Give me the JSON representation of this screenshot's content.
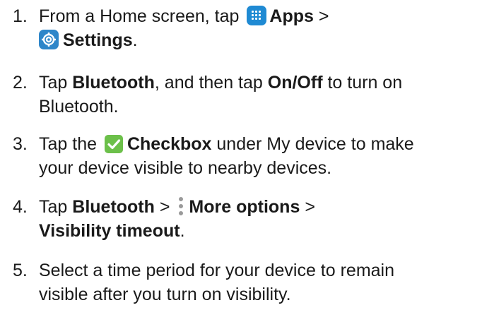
{
  "steps": [
    {
      "num": "1.",
      "parts": {
        "a": "From a Home screen, tap",
        "apps": "Apps",
        "sep": ">",
        "settings": "Settings",
        "end": "."
      },
      "icons": [
        "apps-icon",
        "settings-icon"
      ]
    },
    {
      "num": "2.",
      "parts": {
        "a": "Tap",
        "bluetooth": "Bluetooth",
        "b": ", and then tap",
        "onoff": "On/Off",
        "c": "to turn on",
        "d": "Bluetooth."
      }
    },
    {
      "num": "3.",
      "parts": {
        "a": "Tap the",
        "checkbox": "Checkbox",
        "b": "under My device to make",
        "c": "your device visible to nearby devices."
      },
      "icons": [
        "checkbox-icon"
      ]
    },
    {
      "num": "4.",
      "parts": {
        "a": "Tap",
        "bluetooth": "Bluetooth",
        "sep1": ">",
        "more": "More options",
        "sep2": ">",
        "visibility": "Visibility timeout",
        "end": "."
      },
      "icons": [
        "more-options-icon"
      ]
    },
    {
      "num": "5.",
      "parts": {
        "a": "Select a time period for your device to remain",
        "b": "visible after you turn on visibility."
      }
    }
  ],
  "colors": {
    "text": "#1a1a1a",
    "apps_icon": "#1f8ad3",
    "settings_icon": "#2e86c9",
    "checkbox_icon": "#6cc04a",
    "more_icon": "#9a9a9a"
  }
}
